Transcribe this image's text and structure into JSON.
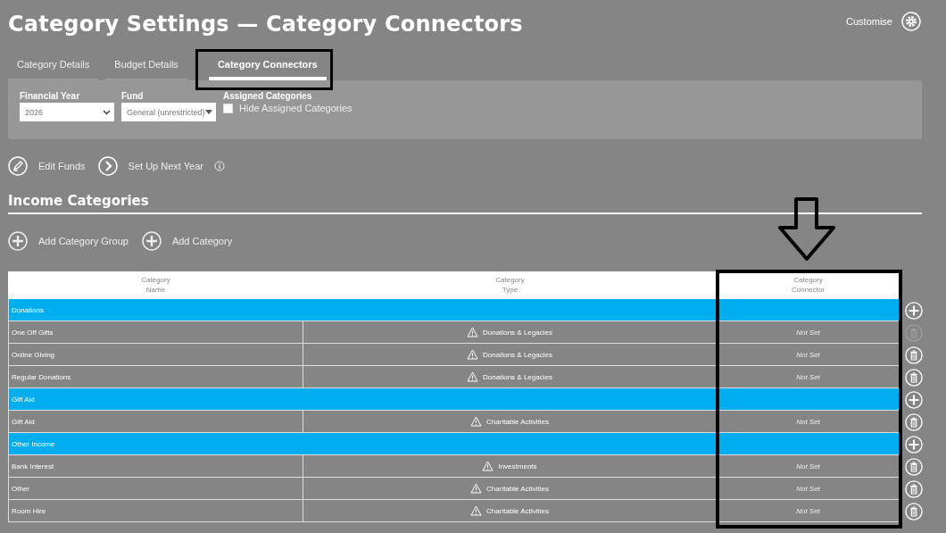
{
  "page": {
    "title": "Category Settings — Category Connectors",
    "customise": "Customise"
  },
  "tabs": [
    {
      "label": "Category Details",
      "selected": false
    },
    {
      "label": "Budget Details",
      "selected": false
    },
    {
      "label": "Category Connectors",
      "selected": true
    }
  ],
  "filters": {
    "financial_year": {
      "label": "Financial Year",
      "value": "2026"
    },
    "fund": {
      "label": "Fund",
      "value": "General (unrestricted)"
    },
    "assigned": {
      "label": "Assigned Categories",
      "checkbox_label": "Hide Assigned Categories",
      "checked": false
    }
  },
  "actions": [
    {
      "kind": "edit",
      "label": "Edit Funds"
    },
    {
      "kind": "next",
      "label": "Set Up Next Year",
      "info": true
    }
  ],
  "section": {
    "title": "Income Categories",
    "add_actions": [
      "Add Category Group",
      "Add Category"
    ]
  },
  "table": {
    "columns": [
      "Category\nName",
      "Category\nType",
      "Category\nConnector"
    ],
    "rows": [
      {
        "kind": "group",
        "name": "Donations"
      },
      {
        "kind": "category",
        "name": "One Off Gifts",
        "type": "Donations & Legacies",
        "connector": "Not Set",
        "delete_disabled": true
      },
      {
        "kind": "category",
        "name": "Online Giving",
        "type": "Donations & Legacies",
        "connector": "Not Set",
        "delete_disabled": false
      },
      {
        "kind": "category",
        "name": "Regular Donations",
        "type": "Donations & Legacies",
        "connector": "Not Set",
        "delete_disabled": false
      },
      {
        "kind": "group",
        "name": "Gift Aid"
      },
      {
        "kind": "category",
        "name": "Gift Aid",
        "type": "Charitable Activities",
        "connector": "Not Set",
        "delete_disabled": false
      },
      {
        "kind": "group",
        "name": "Other Income"
      },
      {
        "kind": "category",
        "name": "Bank Interest",
        "type": "Investments",
        "connector": "Not Set",
        "delete_disabled": false
      },
      {
        "kind": "category",
        "name": "Other",
        "type": "Charitable Activities",
        "connector": "Not Set",
        "delete_disabled": false
      },
      {
        "kind": "category",
        "name": "Room Hire",
        "type": "Charitable Activities",
        "connector": "Not Set",
        "delete_disabled": false
      }
    ]
  }
}
